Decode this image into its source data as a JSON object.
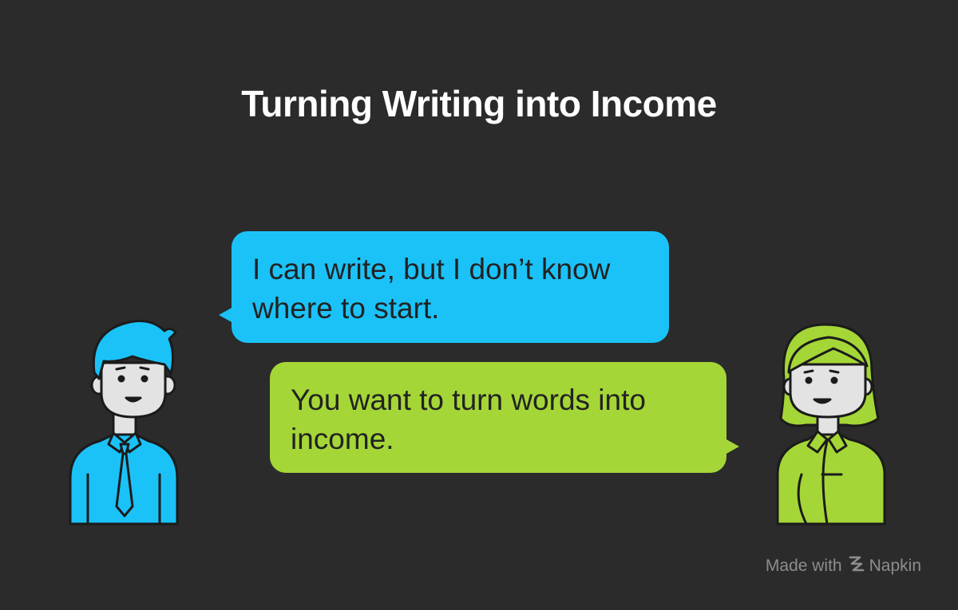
{
  "title": "Turning Writing into Income",
  "conversation": {
    "left_message": "I can write, but I don’t know where to start.",
    "right_message": "You want to turn words into income."
  },
  "colors": {
    "background": "#2b2b2b",
    "left_accent": "#1bc2f8",
    "right_accent": "#a5d637"
  },
  "icons": {
    "left_speaker": "man-with-tie-icon",
    "right_speaker": "woman-icon",
    "footer_logo": "napkin-logo-icon"
  },
  "footer": {
    "made_with": "Made with",
    "brand": "Napkin"
  }
}
